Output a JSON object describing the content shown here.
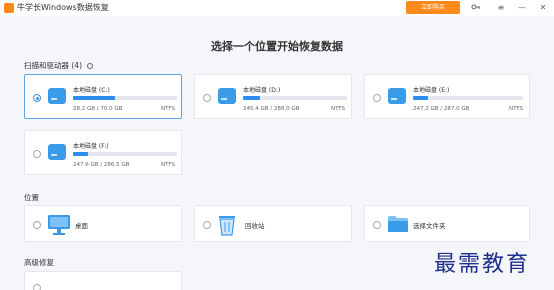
{
  "titlebar": {
    "title": "牛学长Windows数据恢复",
    "buy_label": "立即购买",
    "icons": [
      "key-icon",
      "settings-icon",
      "minimize-icon",
      "close-icon"
    ]
  },
  "heading": "选择一个位置开始恢复数据",
  "drives_section": {
    "label": "扫描和驱动器 (4)",
    "drives": [
      {
        "name": "本地磁盘 (C:)",
        "size": "28.2 GB / 70.0 GB",
        "fs": "NTFS",
        "used_fraction": 0.4,
        "selected": true
      },
      {
        "name": "本地磁盘 (D:)",
        "size": "245.4 GB / 288.0 GB",
        "fs": "NTFS",
        "used_fraction": 0.16,
        "selected": false
      },
      {
        "name": "本地磁盘 (E:)",
        "size": "247.2 GB / 287.0 GB",
        "fs": "NTFS",
        "used_fraction": 0.14,
        "selected": false
      },
      {
        "name": "本地磁盘 (F:)",
        "size": "247.6 GB / 286.5 GB",
        "fs": "NTFS",
        "used_fraction": 0.14,
        "selected": false
      }
    ]
  },
  "location_section": {
    "label": "位置",
    "items": [
      {
        "label": "桌面",
        "icon": "monitor-icon"
      },
      {
        "label": "回收站",
        "icon": "recycle-bin-icon"
      },
      {
        "label": "选择文件夹",
        "icon": "folder-icon"
      }
    ]
  },
  "advanced_section": {
    "label": "高级修复"
  },
  "watermark": "最需教育",
  "colors": {
    "accent": "#2d8cf0",
    "buy": "#ff8a1c",
    "selected_border": "#5aa6e8"
  }
}
